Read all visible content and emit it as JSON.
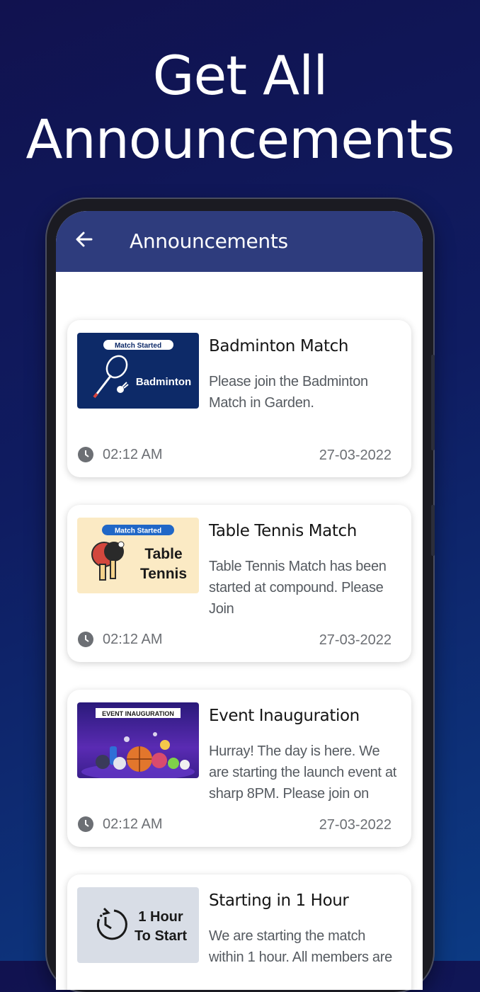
{
  "headline": {
    "line1": "Get All",
    "line2": "Announcements"
  },
  "appbar": {
    "title": "Announcements",
    "back_icon": "back-arrow-icon"
  },
  "announcements": [
    {
      "title": "Badminton Match",
      "body": "Please join the Badminton Match in Garden.",
      "time": "02:12 AM",
      "date": "27-03-2022",
      "thumb": {
        "badge": "Match Started",
        "label": "Badminton",
        "bg": "#0d2a68"
      }
    },
    {
      "title": "Table Tennis Match",
      "body": "Table Tennis Match has been started at compound. Please Join",
      "time": "02:12 AM",
      "date": "27-03-2022",
      "thumb": {
        "badge": "Match Started",
        "label1": "Table",
        "label2": "Tennis",
        "bg": "#fbeac4"
      }
    },
    {
      "title": "Event Inauguration",
      "body": "Hurray! The day is here. We are starting the launch event at sharp 8PM. Please join on",
      "time": "02:12 AM",
      "date": "27-03-2022",
      "thumb": {
        "badge": "EVENT INAUGURATION",
        "bg": "#3a1f8c"
      }
    },
    {
      "title": "Starting in 1 Hour",
      "body": "We are starting the match within 1 hour. All members are",
      "thumb": {
        "label1": "1 Hour",
        "label2": "To Start",
        "bg": "#d8dde6"
      }
    }
  ]
}
